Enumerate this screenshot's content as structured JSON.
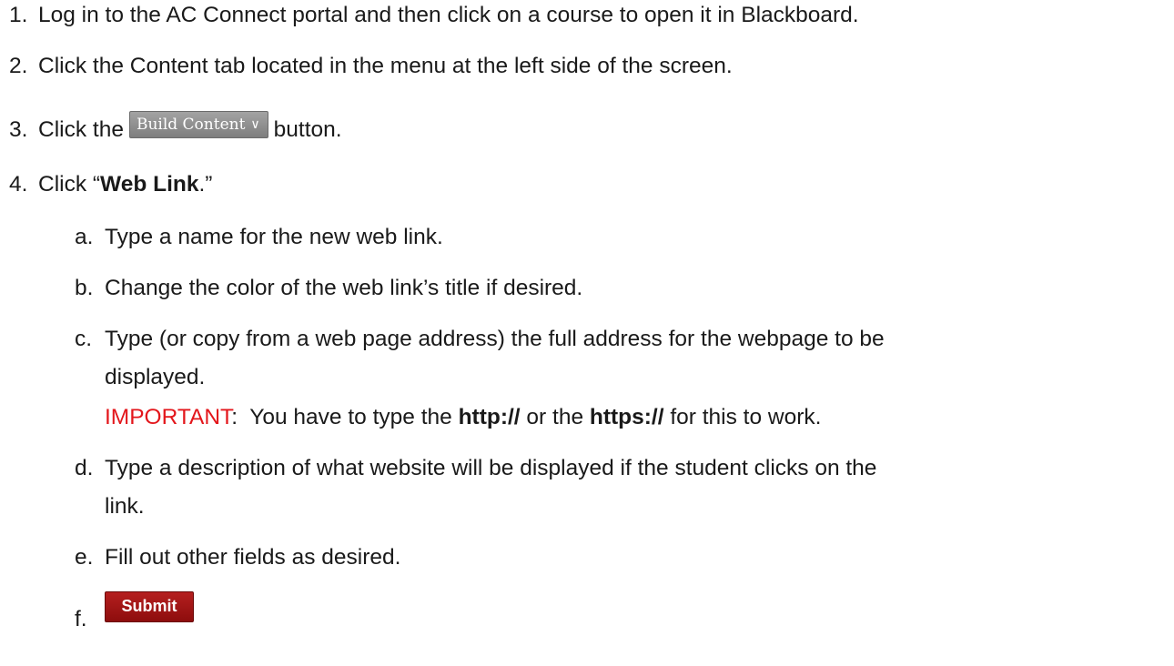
{
  "steps": [
    {
      "num": "1.",
      "text": "Log in to the AC Connect portal and then click on a course to open it in Blackboard."
    },
    {
      "num": "2.",
      "text": "Click the Content tab located in the menu at the left side of the screen."
    },
    {
      "num": "3.",
      "before": "Click the",
      "button": "Build Content",
      "after": "button."
    },
    {
      "num": "4.",
      "before": "Click “",
      "bold": "Web Link",
      "after": ".”"
    }
  ],
  "substeps": {
    "a": {
      "label": "a.",
      "text": "Type a name for the new web link."
    },
    "b": {
      "label": "b.",
      "text": "Change the color of the web link’s title if desired."
    },
    "c": {
      "label": "c.",
      "line1": "Type (or copy from a web page address) the full address for the webpage to be",
      "line2": "displayed.",
      "important_label": "IMPORTANT",
      "important_pre": ":  You have to type the ",
      "http": "http://",
      "or_the": " or the ",
      "https": "https://",
      "important_post": " for this to work."
    },
    "d": {
      "label": "d.",
      "line1": "Type a description of what website will be displayed if the student clicks on the",
      "line2": "link."
    },
    "e": {
      "label": "e.",
      "text": "Fill out other fields as desired."
    },
    "f": {
      "label": "f.",
      "button": "Submit"
    }
  },
  "colors": {
    "important": "#e3161b",
    "submit_button": "#9e1414",
    "build_button": "#8f8f8f"
  },
  "icons": {
    "build_chevron": "chevron-down-icon"
  }
}
